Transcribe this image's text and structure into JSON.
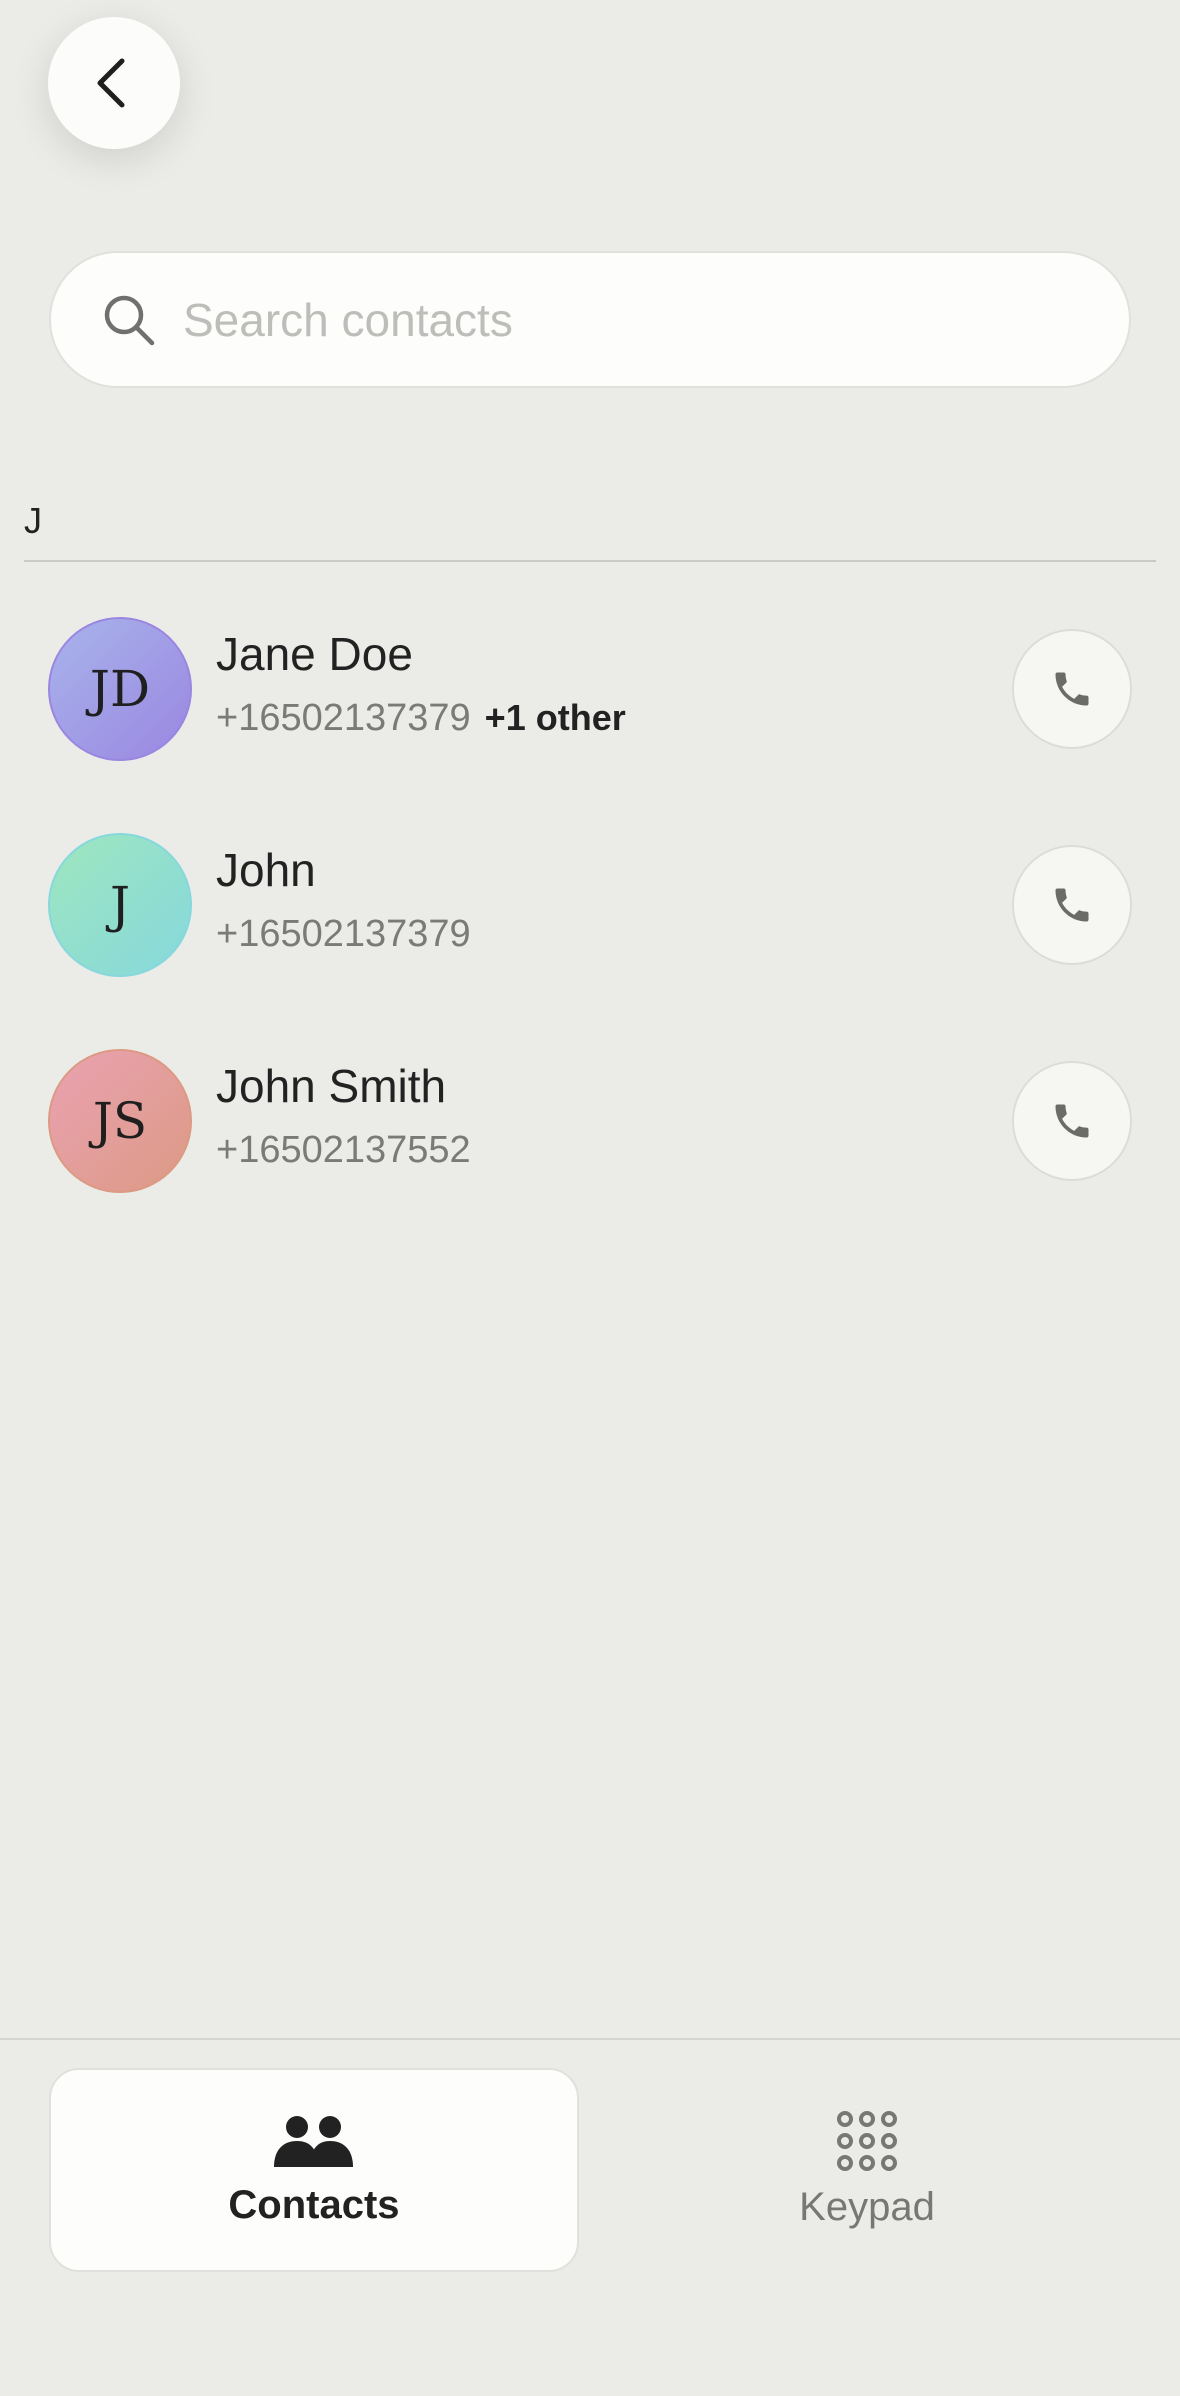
{
  "search": {
    "placeholder": "Search contacts",
    "value": ""
  },
  "section": {
    "header": "J"
  },
  "contacts": [
    {
      "initials": "JD",
      "name": "Jane Doe",
      "phone": "+16502137379",
      "extra": "+1 other",
      "avatar_gradient": [
        "#a8b4ec",
        "#9a86e0"
      ]
    },
    {
      "initials": "J",
      "name": "John",
      "phone": "+16502137379",
      "extra": "",
      "avatar_gradient": [
        "#9ee6bf",
        "#86d8dc"
      ]
    },
    {
      "initials": "JS",
      "name": "John Smith",
      "phone": "+16502137552",
      "extra": "",
      "avatar_gradient": [
        "#eaa2b2",
        "#dc9a84"
      ]
    }
  ],
  "tabs": [
    {
      "label": "Contacts",
      "icon": "people-icon",
      "active": true
    },
    {
      "label": "Keypad",
      "icon": "keypad-icon",
      "active": false
    }
  ],
  "icons": {
    "back": "chevron-left-icon",
    "search": "search-icon",
    "call": "phone-icon"
  },
  "colors": {
    "background": "#ebebe8",
    "surface": "#fdfdfb",
    "text_primary": "#222222",
    "text_secondary": "#7a7a77",
    "icon_muted": "#6b6b68"
  }
}
